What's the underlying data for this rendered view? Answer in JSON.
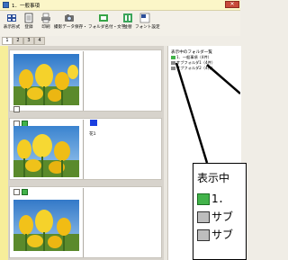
{
  "window": {
    "title": "1．一般事項",
    "close_label": "✕"
  },
  "toolbar": {
    "buttons": [
      {
        "label": "表示形式",
        "icon": "view-mode-icon"
      },
      {
        "label": "登録",
        "icon": "register-icon"
      },
      {
        "label": "印刷",
        "icon": "print-icon"
      },
      {
        "label": "撮影データ保存・",
        "icon": "camera-save-icon"
      },
      {
        "label": "フォルダ名付・文字",
        "icon": "folder-icon"
      },
      {
        "label": "並替",
        "icon": "sort-icon"
      },
      {
        "label": "フォント設定",
        "icon": "font-icon"
      }
    ]
  },
  "tabs": [
    "1",
    "2",
    "3",
    "4"
  ],
  "cards": [
    {
      "label": ""
    },
    {
      "label": "花1"
    },
    {
      "label": ""
    }
  ],
  "right_panel": {
    "title": "表示中のフォルダ一覧",
    "items": [
      {
        "label": "1．一般事項（4件）"
      },
      {
        "label": "サブフォルダ1（4件）"
      },
      {
        "label": "サブフォルダ2（4件）"
      }
    ]
  },
  "zoom": {
    "title": "表示中",
    "rows": [
      "1．",
      "サブ",
      "サブ"
    ]
  },
  "colors": {
    "titlebar": "#fbf6c8",
    "accent_green": "#42b34a",
    "accent_blue": "#1a3fe0",
    "close_red": "#c84a3a"
  }
}
